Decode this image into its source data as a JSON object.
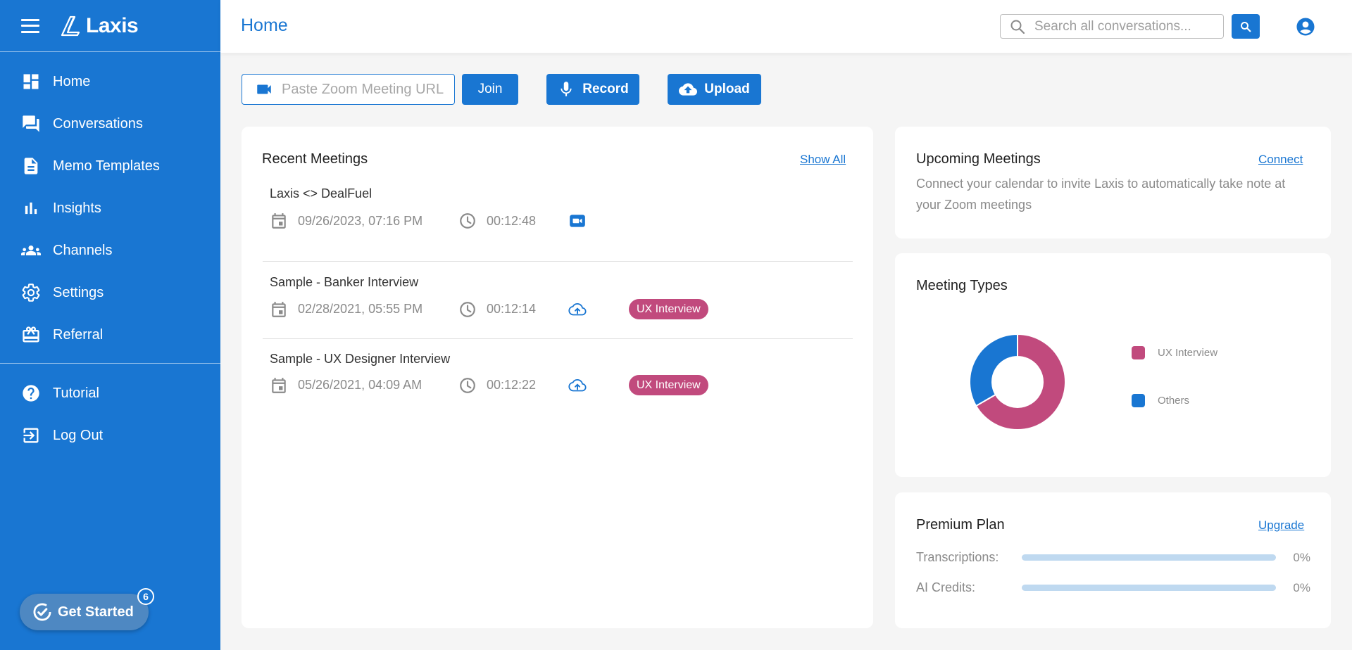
{
  "app": {
    "name": "Laxis"
  },
  "sidebar": {
    "items": [
      {
        "label": "Home",
        "icon": "dashboard-icon"
      },
      {
        "label": "Conversations",
        "icon": "chat-icon"
      },
      {
        "label": "Memo Templates",
        "icon": "document-icon"
      },
      {
        "label": "Insights",
        "icon": "bar-chart-icon"
      },
      {
        "label": "Channels",
        "icon": "group-icon"
      },
      {
        "label": "Settings",
        "icon": "gear-icon"
      },
      {
        "label": "Referral",
        "icon": "gift-icon"
      }
    ],
    "bottom_items": [
      {
        "label": "Tutorial",
        "icon": "help-icon"
      },
      {
        "label": "Log Out",
        "icon": "logout-icon"
      }
    ],
    "get_started": {
      "label": "Get Started",
      "badge": "6"
    }
  },
  "header": {
    "title": "Home",
    "search_placeholder": "Search all conversations..."
  },
  "actions": {
    "zoom_placeholder": "Paste Zoom Meeting URL",
    "join_label": "Join",
    "record_label": "Record",
    "upload_label": "Upload"
  },
  "recent_meetings": {
    "title": "Recent Meetings",
    "show_all": "Show All",
    "items": [
      {
        "title": "Laxis <> DealFuel",
        "date": "09/26/2023, 07:16 PM",
        "duration": "00:12:48",
        "source_icon": "zoom-video-icon",
        "tag": ""
      },
      {
        "title": "Sample - Banker Interview",
        "date": "02/28/2021, 05:55 PM",
        "duration": "00:12:14",
        "source_icon": "cloud-upload-icon",
        "tag": "UX Interview"
      },
      {
        "title": "Sample - UX Designer Interview",
        "date": "05/26/2021, 04:09 AM",
        "duration": "00:12:22",
        "source_icon": "cloud-upload-icon",
        "tag": "UX Interview"
      }
    ]
  },
  "upcoming_meetings": {
    "title": "Upcoming Meetings",
    "connect": "Connect",
    "text": "Connect your calendar to invite Laxis to automatically take note at your Zoom meetings"
  },
  "meeting_types": {
    "title": "Meeting Types"
  },
  "chart_data": {
    "type": "pie",
    "title": "Meeting Types",
    "donut": true,
    "series": [
      {
        "name": "UX Interview",
        "value": 2,
        "color": "#c14a7d"
      },
      {
        "name": "Others",
        "value": 1,
        "color": "#1976d2"
      }
    ],
    "legend": "right"
  },
  "premium_plan": {
    "title": "Premium Plan",
    "upgrade": "Upgrade",
    "rows": [
      {
        "label": "Transcriptions:",
        "value": "0%",
        "fraction": 0
      },
      {
        "label": "AI Credits:",
        "value": "0%",
        "fraction": 0
      }
    ]
  },
  "colors": {
    "primary": "#1976d2",
    "tag": "#c14a7d",
    "muted": "#8a8a8a"
  }
}
